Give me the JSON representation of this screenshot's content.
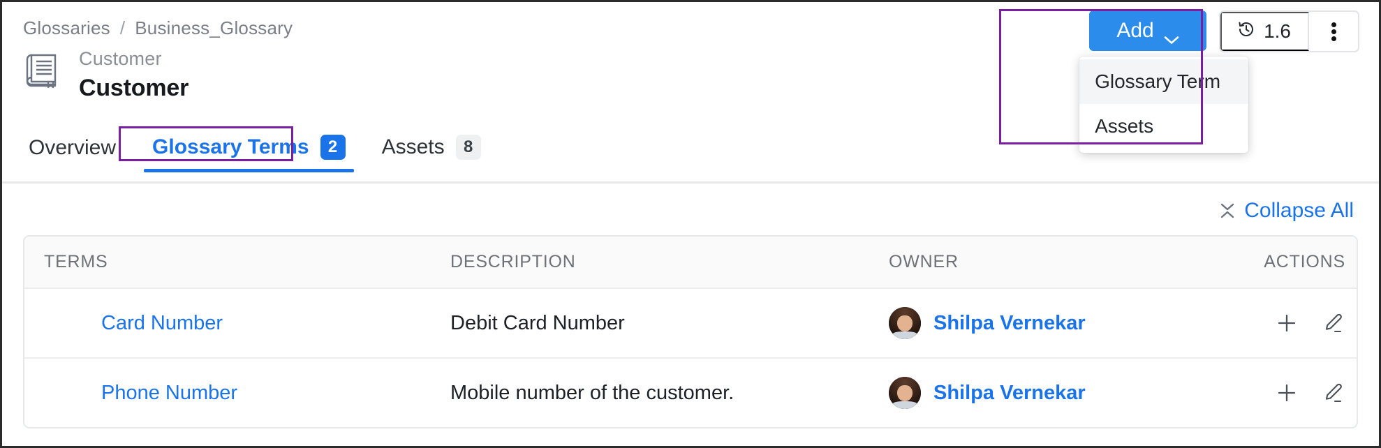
{
  "breadcrumb": {
    "items": [
      "Glossaries",
      "Business_Glossary"
    ],
    "separator": "/"
  },
  "header": {
    "entity_icon": "glossary-book-icon",
    "subtitle": "Customer",
    "title": "Customer"
  },
  "top_right": {
    "add_button": {
      "label": "Add",
      "icon": "chevron-down-icon",
      "color": "#2c8ceb"
    },
    "add_menu": {
      "items": [
        {
          "label": "Glossary Term",
          "hovered": true
        },
        {
          "label": "Assets",
          "hovered": false
        }
      ]
    },
    "version_button": {
      "icon": "history-clock-icon",
      "label": "1.6"
    },
    "kebab_menu": {
      "icon": "vertical-dots-icon"
    }
  },
  "tabs": [
    {
      "label": "Overview",
      "badge": null,
      "active": false
    },
    {
      "label": "Glossary Terms",
      "badge": "2",
      "active": true
    },
    {
      "label": "Assets",
      "badge": "8",
      "active": false
    }
  ],
  "toolbar": {
    "collapse_all": {
      "label": "Collapse All",
      "icon": "collapse-all-icon",
      "color": "#1a73e8"
    }
  },
  "table": {
    "columns": [
      "TERMS",
      "DESCRIPTION",
      "OWNER",
      "ACTIONS"
    ],
    "rows": [
      {
        "term": "Card Number",
        "description": "Debit Card Number",
        "owner": "Shilpa Vernekar",
        "owner_avatar": "user-photo-avatar",
        "actions": [
          "plus-icon",
          "pencil-edit-icon"
        ]
      },
      {
        "term": "Phone Number",
        "description": "Mobile number of the customer.",
        "owner": "Shilpa Vernekar",
        "owner_avatar": "user-photo-avatar",
        "actions": [
          "plus-icon",
          "pencil-edit-icon"
        ]
      }
    ]
  },
  "annotations": {
    "color": "#7b1fa2",
    "boxes": [
      "glossary-terms-tab",
      "add-button-menu"
    ]
  }
}
